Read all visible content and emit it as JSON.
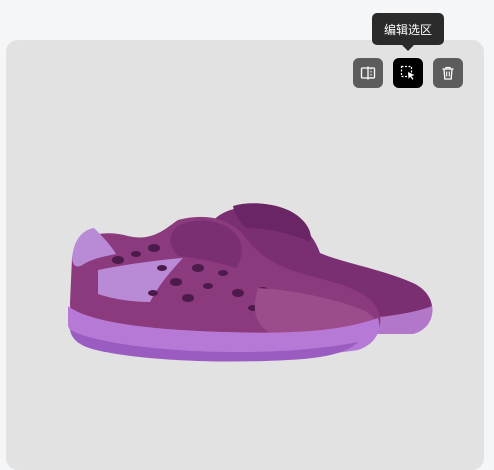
{
  "tooltip": {
    "text": "编辑选区"
  },
  "toolbar": {
    "buttons": [
      {
        "name": "compare",
        "icon": "split-compare-icon"
      },
      {
        "name": "edit-selection",
        "icon": "selection-cursor-icon",
        "active": true
      },
      {
        "name": "delete",
        "icon": "trash-icon"
      }
    ]
  },
  "colors": {
    "page_background": "#f5f6f8",
    "canvas_background": "#e2e2e2",
    "button_background": "#5c5c5c",
    "button_active": "#000000",
    "tooltip_background": "#2b2b2b"
  },
  "image": {
    "subject": "sneaker-product-photo"
  }
}
